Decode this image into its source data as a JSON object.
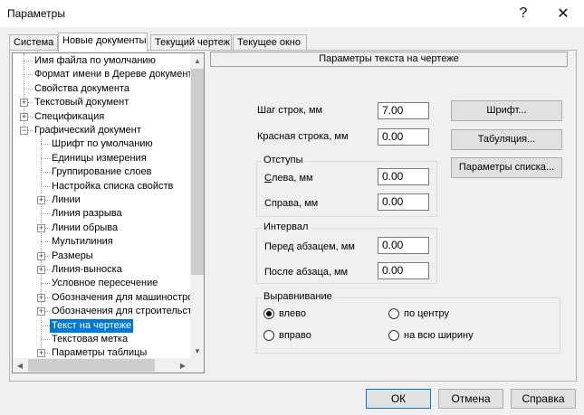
{
  "window": {
    "title": "Параметры",
    "help_glyph": "?",
    "close_glyph": "✕"
  },
  "tabs": [
    {
      "label": "Система",
      "active": false
    },
    {
      "label": "Новые документы",
      "active": true
    },
    {
      "label": "Текущий чертеж",
      "active": false
    },
    {
      "label": "Текущее окно",
      "active": false
    }
  ],
  "tree": {
    "items": [
      {
        "label": "Имя файла по умолчанию",
        "level": 1,
        "expander": ""
      },
      {
        "label": "Формат имени в Дереве документа",
        "level": 1,
        "expander": ""
      },
      {
        "label": "Свойства документа",
        "level": 1,
        "expander": ""
      },
      {
        "label": "Текстовый документ",
        "level": 1,
        "expander": "+"
      },
      {
        "label": "Спецификация",
        "level": 1,
        "expander": "+"
      },
      {
        "label": "Графический документ",
        "level": 1,
        "expander": "−"
      },
      {
        "label": "Шрифт по умолчанию",
        "level": 2,
        "expander": ""
      },
      {
        "label": "Единицы измерения",
        "level": 2,
        "expander": ""
      },
      {
        "label": "Группирование слоев",
        "level": 2,
        "expander": ""
      },
      {
        "label": "Настройка списка свойств",
        "level": 2,
        "expander": ""
      },
      {
        "label": "Линии",
        "level": 2,
        "expander": "+"
      },
      {
        "label": "Линия разрыва",
        "level": 2,
        "expander": ""
      },
      {
        "label": "Линии обрыва",
        "level": 2,
        "expander": "+"
      },
      {
        "label": "Мультилиния",
        "level": 2,
        "expander": ""
      },
      {
        "label": "Размеры",
        "level": 2,
        "expander": "+"
      },
      {
        "label": "Линия-выноска",
        "level": 2,
        "expander": "+"
      },
      {
        "label": "Условное пересечение",
        "level": 2,
        "expander": ""
      },
      {
        "label": "Обозначения для машиностроения",
        "level": 2,
        "expander": "+"
      },
      {
        "label": "Обозначения для строительства",
        "level": 2,
        "expander": "+"
      },
      {
        "label": "Текст на чертеже",
        "level": 2,
        "expander": "",
        "selected": true
      },
      {
        "label": "Текстовая метка",
        "level": 2,
        "expander": ""
      },
      {
        "label": "Параметры таблицы",
        "level": 2,
        "expander": "+"
      }
    ],
    "scroll_up": "▲",
    "scroll_down": "▼",
    "scroll_left": "◀",
    "scroll_right": "▶"
  },
  "panel": {
    "header": "Параметры текста на чертеже",
    "line_spacing": {
      "label": "Шаг строк, мм",
      "value": "7.00"
    },
    "first_line": {
      "label": "Красная строка, мм",
      "value": "0.00"
    },
    "indents": {
      "title": "Отступы",
      "left": {
        "label": "Слева, мм",
        "value": "0.00"
      },
      "right": {
        "label": "Справа, мм",
        "value": "0.00"
      }
    },
    "interval": {
      "title": "Интервал",
      "before": {
        "label": "Перед абзацем, мм",
        "value": "0.00"
      },
      "after": {
        "label": "После абзаца, мм",
        "value": "0.00"
      }
    },
    "alignment": {
      "title": "Выравнивание",
      "left": "влево",
      "center": "по центру",
      "right": "вправо",
      "justify": "на всю ширину",
      "selected": "left"
    },
    "font_button": "Шрифт...",
    "tabulation_button": "Табуляция...",
    "list_params_button": "Параметры списка..."
  },
  "footer": {
    "ok": "ОК",
    "cancel": "Отмена",
    "help": "Справка"
  }
}
